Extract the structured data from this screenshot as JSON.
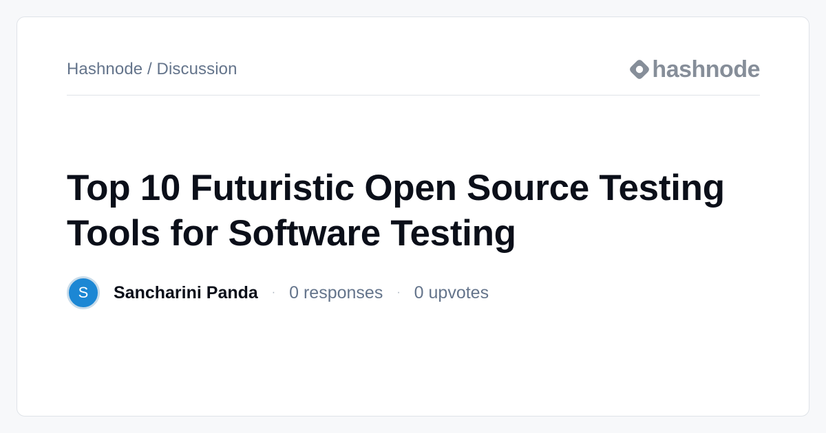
{
  "breadcrumb": "Hashnode / Discussion",
  "logo": {
    "text": "hashnode",
    "icon": "hashnode-logo-icon"
  },
  "title": "Top 10 Futuristic Open Source Testing Tools for Software Testing",
  "author": {
    "initial": "S",
    "name": "Sancharini Panda"
  },
  "separator": "·",
  "stats": {
    "responses": "0 responses",
    "upvotes": "0 upvotes"
  },
  "colors": {
    "avatar": "#1c87d4",
    "muted_text": "#64748b",
    "title_text": "#0b0f19",
    "logo": "#868e99"
  }
}
